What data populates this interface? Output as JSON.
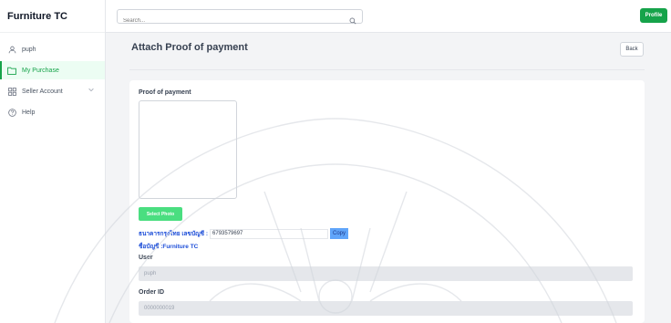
{
  "app": {
    "brand": "Furniture TC"
  },
  "sidebar": {
    "items": [
      {
        "label": "puph",
        "icon": "user-icon"
      },
      {
        "label": "My Purchase",
        "icon": "folder-icon",
        "active": true
      },
      {
        "label": "Seller Account",
        "icon": "grid-icon"
      },
      {
        "label": "Help",
        "icon": "help-icon"
      }
    ]
  },
  "topbar": {
    "search_placeholder": "Search...",
    "profile_label": "Profile"
  },
  "page": {
    "title": "Attach Proof of payment",
    "back_label": "Back"
  },
  "form": {
    "proof_label": "Proof of payment",
    "select_photo_label": "Select Photo",
    "bank_label": "ธนาคารกรุงไทย เลขบัญชี :",
    "bank_number": "6793579697",
    "copy_label": "Copy",
    "account_name": "ชื่อบัญชี :Furniture TC",
    "user_label": "User",
    "user_value": "puph",
    "order_label": "Order ID",
    "order_value": "0000000019"
  },
  "colors": {
    "accent": "#16a34a",
    "select_photo": "#4ade80",
    "copy_button": "#60a5fa",
    "bank_text": "#1d4ed8"
  }
}
